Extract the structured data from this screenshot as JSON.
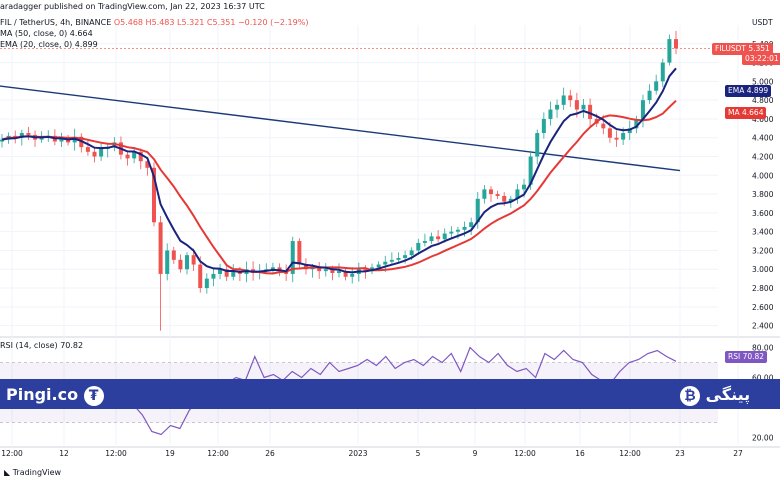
{
  "header": {
    "published": "aradagger published on TradingView.com, Jan 22, 2023 16:37 UTC",
    "symbol_line": "FIL / TetherUS, 4h, BINANCE",
    "ohlc": "O5.468 H5.483 L5.321 C5.351 −0.120 (−2.19%)",
    "ma_line": "MA (50, close, 0) 4.664",
    "ema_line": "EMA (20, close, 0) 4.899",
    "rsi_line": "RSI (14, close) 70.82"
  },
  "axis": {
    "currency": "USDT"
  },
  "tags": {
    "price_symbol": "FILUSDT",
    "price_value": "5.351",
    "countdown": "03:22:01",
    "ema_label": "EMA",
    "ema_value": "4.899",
    "ma_label": "MA",
    "ma_value": "4.664",
    "rsi_label": "RSI",
    "rsi_value": "70.82"
  },
  "branding": {
    "left": "Pingi.co",
    "right": "پینگی",
    "footer": "TradingView"
  },
  "colors": {
    "ema": "#1a237e",
    "ma": "#e53935",
    "up": "#26a69a",
    "down": "#ef5350",
    "rsi": "#7e57c2",
    "trendline": "#1a3a7a",
    "banner": "#2c3e9e"
  },
  "chart_data": [
    {
      "type": "candlestick",
      "title": "FIL / TetherUS, 4h, BINANCE",
      "ylabel": "USDT",
      "ylim": [
        2.3,
        5.6
      ],
      "y_ticks": [
        2.4,
        2.6,
        2.8,
        3.0,
        3.2,
        3.4,
        3.6,
        3.8,
        4.0,
        4.2,
        4.4,
        4.6,
        4.8,
        5.0,
        5.2,
        5.4
      ],
      "x_ticks": [
        "12:00",
        "12",
        "12:00",
        "19",
        "12:00",
        "26",
        "2023",
        "5",
        "9",
        "12:00",
        "16",
        "12:00",
        "23",
        "27"
      ],
      "x_tick_positions": [
        12,
        64,
        116,
        170,
        218,
        270,
        358,
        418,
        475,
        525,
        580,
        630,
        680,
        738
      ],
      "candles_close": [
        4.38,
        4.42,
        4.4,
        4.45,
        4.43,
        4.38,
        4.4,
        4.42,
        4.36,
        4.39,
        4.35,
        4.41,
        4.3,
        4.25,
        4.2,
        4.28,
        4.3,
        4.35,
        4.22,
        4.18,
        4.25,
        4.15,
        4.08,
        3.5,
        2.95,
        3.2,
        3.1,
        3.0,
        3.15,
        3.05,
        2.8,
        2.9,
        2.95,
        3.0,
        2.92,
        2.98,
        2.95,
        3.0,
        2.96,
        2.98,
        3.0,
        3.02,
        2.98,
        2.95,
        3.3,
        3.05,
        3.0,
        3.02,
        2.98,
        3.0,
        2.96,
        2.98,
        2.92,
        2.95,
        3.0,
        2.98,
        3.02,
        3.05,
        3.08,
        3.1,
        3.12,
        3.15,
        3.2,
        3.28,
        3.3,
        3.35,
        3.32,
        3.38,
        3.4,
        3.42,
        3.45,
        3.5,
        3.75,
        3.85,
        3.8,
        3.78,
        3.72,
        3.75,
        3.85,
        3.9,
        4.2,
        4.45,
        4.6,
        4.7,
        4.75,
        4.85,
        4.8,
        4.7,
        4.75,
        4.6,
        4.55,
        4.5,
        4.4,
        4.38,
        4.45,
        4.5,
        4.6,
        4.8,
        4.9,
        5.0,
        5.2,
        5.45,
        5.351
      ],
      "series": [
        {
          "name": "MA (50, close, 0)",
          "last": 4.664
        },
        {
          "name": "EMA (20, close, 0)",
          "last": 4.899
        }
      ],
      "last_price": 5.351,
      "trendline": {
        "from": [
          0,
          4.95
        ],
        "to": [
          680,
          4.05
        ]
      },
      "grid": true
    },
    {
      "type": "line",
      "title": "RSI (14, close)",
      "ylim": [
        15,
        85
      ],
      "y_ticks": [
        20.0,
        60.0,
        80.0
      ],
      "bands": [
        70,
        30
      ],
      "values": [
        52,
        48,
        50,
        46,
        44,
        48,
        45,
        50,
        46,
        42,
        40,
        48,
        44,
        52,
        42,
        35,
        24,
        22,
        28,
        26,
        38,
        46,
        50,
        44,
        56,
        60,
        58,
        74,
        60,
        62,
        58,
        64,
        60,
        66,
        62,
        70,
        64,
        66,
        68,
        72,
        68,
        74,
        66,
        70,
        72,
        68,
        74,
        70,
        76,
        64,
        80,
        74,
        70,
        76,
        68,
        64,
        66,
        60,
        76,
        72,
        78,
        72,
        70,
        62,
        58,
        56,
        64,
        70,
        72,
        76,
        78,
        74,
        70.82
      ],
      "last": 70.82
    }
  ]
}
